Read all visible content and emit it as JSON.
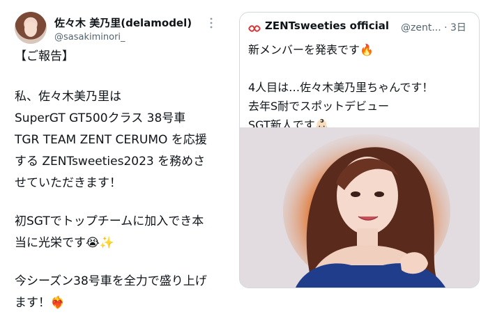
{
  "tweet": {
    "author_name": "佐々木 美乃里(delamodel)",
    "author_handle": "@sasakiminori_",
    "more_icon": "more-vertical-icon",
    "body": {
      "p1": "【ご報告】",
      "p2": "私、佐々木美乃里は\nSuperGT GT500クラス 38号車\nTGR TEAM ZENT CERUMO を応援\nする ZENTsweeties2023 を務めさ\nせていただきます！",
      "p3": "初SGTでトップチームに加入でき本\n当に光栄です😭✨",
      "p4": "今シーズン38号車を全力で盛り上げ\nます！❤️‍🔥"
    }
  },
  "quote": {
    "logo_icon": "zent-logo-icon",
    "author_name": "ZENTsweeties official",
    "meta": "@zent... · 3日",
    "text": "新メンバーを発表です🔥\n\n4人目は…佐々木美乃里ちゃんです！\n去年S耐でスポットデビュー\nSGT新人です👶🏻...",
    "photo_icon": "portrait-photo"
  },
  "colors": {
    "text": "#0f1419",
    "secondary": "#536471",
    "border": "#cfd9de",
    "logo_red": "#d43a3a"
  }
}
